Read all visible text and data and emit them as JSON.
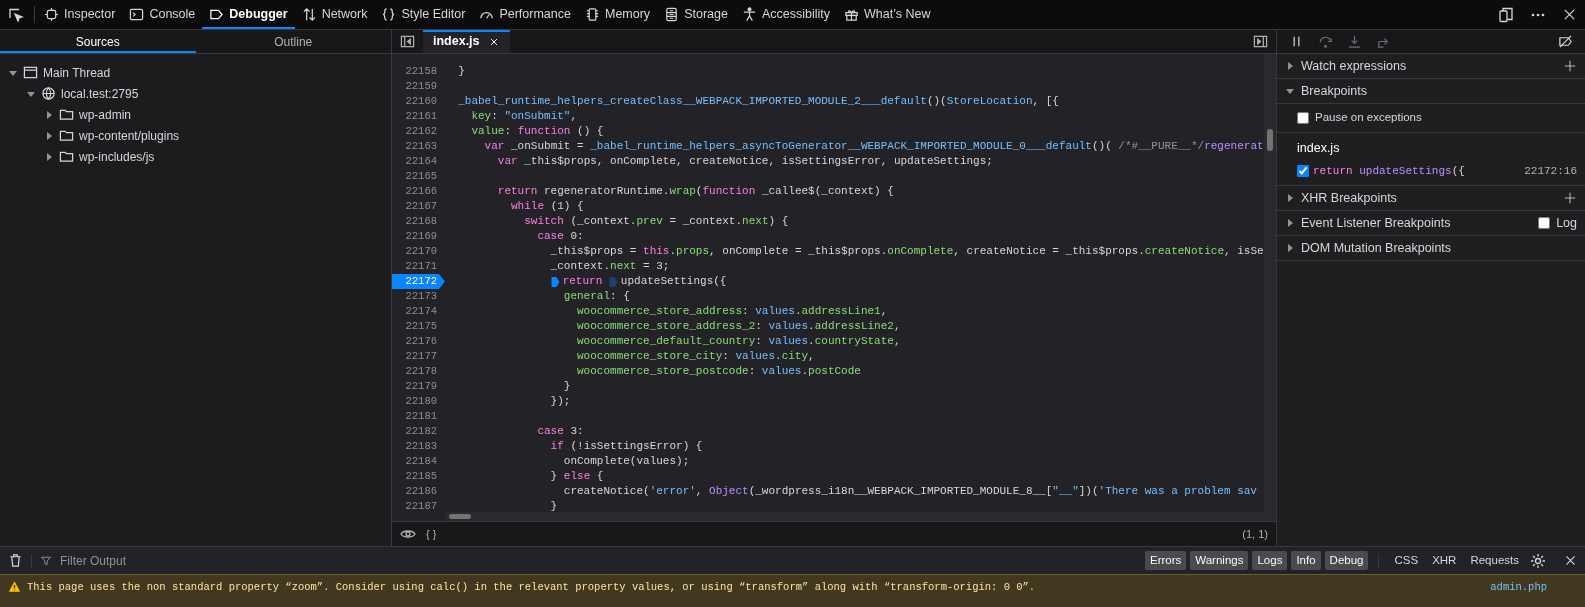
{
  "toolbar": {
    "tabs": [
      {
        "label": "Inspector",
        "kind": "inspector",
        "selected": false
      },
      {
        "label": "Console",
        "kind": "console",
        "selected": false
      },
      {
        "label": "Debugger",
        "kind": "debugger",
        "selected": true
      },
      {
        "label": "Network",
        "kind": "network",
        "selected": false
      },
      {
        "label": "Style Editor",
        "kind": "style",
        "selected": false
      },
      {
        "label": "Performance",
        "kind": "performance",
        "selected": false
      },
      {
        "label": "Memory",
        "kind": "memory",
        "selected": false
      },
      {
        "label": "Storage",
        "kind": "storage",
        "selected": false
      },
      {
        "label": "Accessibility",
        "kind": "accessibility",
        "selected": false
      },
      {
        "label": "What’s New",
        "kind": "whatsnew",
        "selected": false
      }
    ]
  },
  "sources_panel": {
    "tabs": [
      {
        "label": "Sources",
        "selected": true
      },
      {
        "label": "Outline",
        "selected": false
      }
    ],
    "tree": [
      {
        "label": "Main Thread",
        "kind": "thread",
        "expanded": true,
        "children": [
          {
            "label": "local.test:2795",
            "kind": "host",
            "expanded": true,
            "children": [
              {
                "label": "wp-admin",
                "kind": "folder",
                "expanded": false
              },
              {
                "label": "wp-content/plugins",
                "kind": "folder",
                "expanded": false
              },
              {
                "label": "wp-includes/js",
                "kind": "folder",
                "expanded": false
              }
            ]
          }
        ]
      }
    ]
  },
  "editor": {
    "tabs": [
      {
        "label": "index.js",
        "selected": true
      }
    ],
    "lines": [
      {
        "number": "22158",
        "breakpoint": false,
        "tokens": [
          {
            "kind": "plain",
            "text": "  }"
          }
        ]
      },
      {
        "number": "22159",
        "breakpoint": false
      },
      {
        "number": "22160",
        "breakpoint": false,
        "tokens": [
          {
            "kind": "identifier",
            "text": "  _babel_runtime_helpers_createClass__WEBPACK_IMPORTED_MODULE_2___default"
          },
          {
            "kind": "plain",
            "text": "()("
          },
          {
            "kind": "identifier",
            "text": "StoreLocation"
          },
          {
            "kind": "plain",
            "text": ", [{"
          }
        ]
      },
      {
        "number": "22161",
        "breakpoint": false,
        "tokens": [
          {
            "kind": "property",
            "text": "    key"
          },
          {
            "kind": "plain",
            "text": ": "
          },
          {
            "kind": "string",
            "text": "\"onSubmit\""
          },
          {
            "kind": "plain",
            "text": ","
          }
        ]
      },
      {
        "number": "22162",
        "breakpoint": false,
        "tokens": [
          {
            "kind": "property",
            "text": "    value"
          },
          {
            "kind": "plain",
            "text": ": "
          },
          {
            "kind": "keyword",
            "text": "function"
          },
          {
            "kind": "plain",
            "text": " () {"
          }
        ]
      },
      {
        "number": "22163",
        "breakpoint": false,
        "tokens": [
          {
            "kind": "keyword",
            "text": "      var"
          },
          {
            "kind": "plain",
            "text": " _onSubmit = "
          },
          {
            "kind": "identifier",
            "text": "_babel_runtime_helpers_asyncToGenerator__WEBPACK_IMPORTED_MODULE_0___default"
          },
          {
            "kind": "plain",
            "text": "()( "
          },
          {
            "kind": "comment",
            "text": "/*#__PURE__*/"
          },
          {
            "kind": "function",
            "text": "regenerat"
          }
        ]
      },
      {
        "number": "22164",
        "breakpoint": false,
        "tokens": [
          {
            "kind": "keyword",
            "text": "        var"
          },
          {
            "kind": "plain",
            "text": " _this$props, onComplete, createNotice, isSettingsError, updateSettings;"
          }
        ]
      },
      {
        "number": "22165",
        "breakpoint": false
      },
      {
        "number": "22166",
        "breakpoint": false,
        "tokens": [
          {
            "kind": "keyword",
            "text": "        return"
          },
          {
            "kind": "plain",
            "text": " regeneratorRuntime."
          },
          {
            "kind": "property",
            "text": "wrap"
          },
          {
            "kind": "plain",
            "text": "("
          },
          {
            "kind": "keyword",
            "text": "function"
          },
          {
            "kind": "plain",
            "text": " _callee$(_context) {"
          }
        ]
      },
      {
        "number": "22167",
        "breakpoint": false,
        "tokens": [
          {
            "kind": "keyword",
            "text": "          while"
          },
          {
            "kind": "plain",
            "text": " (1) {"
          }
        ]
      },
      {
        "number": "22168",
        "breakpoint": false,
        "tokens": [
          {
            "kind": "keyword",
            "text": "            switch"
          },
          {
            "kind": "plain",
            "text": " (_context."
          },
          {
            "kind": "property",
            "text": "prev"
          },
          {
            "kind": "plain",
            "text": " = _context."
          },
          {
            "kind": "property",
            "text": "next"
          },
          {
            "kind": "plain",
            "text": ") {"
          }
        ]
      },
      {
        "number": "22169",
        "breakpoint": false,
        "tokens": [
          {
            "kind": "keyword",
            "text": "              case"
          },
          {
            "kind": "plain",
            "text": " 0:"
          }
        ]
      },
      {
        "number": "22170",
        "breakpoint": false,
        "tokens": [
          {
            "kind": "plain",
            "text": "                _this$props = "
          },
          {
            "kind": "keyword",
            "text": "this"
          },
          {
            "kind": "plain",
            "text": "."
          },
          {
            "kind": "property",
            "text": "props"
          },
          {
            "kind": "plain",
            "text": ", onComplete = _this$props."
          },
          {
            "kind": "property",
            "text": "onComplete"
          },
          {
            "kind": "plain",
            "text": ", createNotice = _this$props."
          },
          {
            "kind": "property",
            "text": "createNotice"
          },
          {
            "kind": "plain",
            "text": ", isSe"
          }
        ]
      },
      {
        "number": "22171",
        "breakpoint": false,
        "tokens": [
          {
            "kind": "plain",
            "text": "                _context."
          },
          {
            "kind": "property",
            "text": "next"
          },
          {
            "kind": "plain",
            "text": " = 3;"
          }
        ]
      },
      {
        "number": "22172",
        "breakpoint": true,
        "tokens": [
          {
            "kind": "keyword",
            "text": "                return",
            "column_breakpoint": {
              "enabled": true
            }
          },
          {
            "kind": "plain",
            "text": " updateSettings({",
            "column_breakpoint": {
              "enabled": false
            }
          }
        ]
      },
      {
        "number": "22173",
        "breakpoint": false,
        "tokens": [
          {
            "kind": "property",
            "text": "                  general"
          },
          {
            "kind": "plain",
            "text": ": {"
          }
        ]
      },
      {
        "number": "22174",
        "breakpoint": false,
        "tokens": [
          {
            "kind": "property",
            "text": "                    woocommerce_store_address"
          },
          {
            "kind": "plain",
            "text": ": "
          },
          {
            "kind": "identifier",
            "text": "values"
          },
          {
            "kind": "plain",
            "text": "."
          },
          {
            "kind": "property",
            "text": "addressLine1"
          },
          {
            "kind": "plain",
            "text": ","
          }
        ]
      },
      {
        "number": "22175",
        "breakpoint": false,
        "tokens": [
          {
            "kind": "property",
            "text": "                    woocommerce_store_address_2"
          },
          {
            "kind": "plain",
            "text": ": "
          },
          {
            "kind": "identifier",
            "text": "values"
          },
          {
            "kind": "plain",
            "text": "."
          },
          {
            "kind": "property",
            "text": "addressLine2"
          },
          {
            "kind": "plain",
            "text": ","
          }
        ]
      },
      {
        "number": "22176",
        "breakpoint": false,
        "tokens": [
          {
            "kind": "property",
            "text": "                    woocommerce_default_country"
          },
          {
            "kind": "plain",
            "text": ": "
          },
          {
            "kind": "identifier",
            "text": "values"
          },
          {
            "kind": "plain",
            "text": "."
          },
          {
            "kind": "property",
            "text": "countryState"
          },
          {
            "kind": "plain",
            "text": ","
          }
        ]
      },
      {
        "number": "22177",
        "breakpoint": false,
        "tokens": [
          {
            "kind": "property",
            "text": "                    woocommerce_store_city"
          },
          {
            "kind": "plain",
            "text": ": "
          },
          {
            "kind": "identifier",
            "text": "values"
          },
          {
            "kind": "plain",
            "text": "."
          },
          {
            "kind": "property",
            "text": "city"
          },
          {
            "kind": "plain",
            "text": ","
          }
        ]
      },
      {
        "number": "22178",
        "breakpoint": false,
        "tokens": [
          {
            "kind": "property",
            "text": "                    woocommerce_store_postcode"
          },
          {
            "kind": "plain",
            "text": ": "
          },
          {
            "kind": "identifier",
            "text": "values"
          },
          {
            "kind": "plain",
            "text": "."
          },
          {
            "kind": "property",
            "text": "postCode"
          }
        ]
      },
      {
        "number": "22179",
        "breakpoint": false,
        "tokens": [
          {
            "kind": "plain",
            "text": "                  }"
          }
        ]
      },
      {
        "number": "22180",
        "breakpoint": false,
        "tokens": [
          {
            "kind": "plain",
            "text": "                });"
          }
        ]
      },
      {
        "number": "22181",
        "breakpoint": false
      },
      {
        "number": "22182",
        "breakpoint": false,
        "tokens": [
          {
            "kind": "keyword",
            "text": "              case"
          },
          {
            "kind": "plain",
            "text": " 3:"
          }
        ]
      },
      {
        "number": "22183",
        "breakpoint": false,
        "tokens": [
          {
            "kind": "keyword",
            "text": "                if"
          },
          {
            "kind": "plain",
            "text": " (!isSettingsError) {"
          }
        ]
      },
      {
        "number": "22184",
        "breakpoint": false,
        "tokens": [
          {
            "kind": "plain",
            "text": "                  onComplete(values);"
          }
        ]
      },
      {
        "number": "22185",
        "breakpoint": false,
        "tokens": [
          {
            "kind": "plain",
            "text": "                } "
          },
          {
            "kind": "keyword",
            "text": "else"
          },
          {
            "kind": "plain",
            "text": " {"
          }
        ]
      },
      {
        "number": "22186",
        "breakpoint": false,
        "tokens": [
          {
            "kind": "plain",
            "text": "                  createNotice("
          },
          {
            "kind": "string",
            "text": "'error'"
          },
          {
            "kind": "plain",
            "text": ", "
          },
          {
            "kind": "function",
            "text": "Object"
          },
          {
            "kind": "plain",
            "text": "(_wordpress_i18n__WEBPACK_IMPORTED_MODULE_8__["
          },
          {
            "kind": "string",
            "text": "\"__\""
          },
          {
            "kind": "plain",
            "text": "])("
          },
          {
            "kind": "string",
            "text": "'There was a problem sav"
          }
        ]
      },
      {
        "number": "22187",
        "breakpoint": false,
        "tokens": [
          {
            "kind": "plain",
            "text": "                }"
          }
        ]
      }
    ],
    "footer": {
      "pretty_print": "{ }",
      "cursor": "(1, 1)"
    }
  },
  "debugger_panel": {
    "controls": [
      {
        "kind": "pause",
        "disabled": false
      },
      {
        "kind": "step_over",
        "disabled": true
      },
      {
        "kind": "step_in",
        "disabled": true
      },
      {
        "kind": "step_out",
        "disabled": true
      },
      {
        "kind": "toggle_breakpoints",
        "disabled": false
      }
    ],
    "sections": [
      {
        "title": "Watch expressions",
        "expanded": false,
        "add_button": true
      },
      {
        "title": "Breakpoints",
        "expanded": true,
        "pause_on_exceptions": {
          "label": "Pause on exceptions",
          "checked": false
        },
        "breakpoints": [
          {
            "file": "index.js",
            "enabled": true,
            "tokens": [
              {
                "kind": "keyword",
                "text": "return"
              },
              {
                "kind": "function",
                "text": " updateSettings"
              },
              {
                "kind": "plain",
                "text": "({"
              }
            ],
            "location": "22172:16"
          }
        ]
      },
      {
        "title": "XHR Breakpoints",
        "expanded": false,
        "add_button": true
      },
      {
        "title": "Event Listener Breakpoints",
        "expanded": false,
        "log": {
          "label": "Log",
          "checked": false
        }
      },
      {
        "title": "DOM Mutation Breakpoints",
        "expanded": false
      }
    ]
  },
  "console": {
    "filter": {
      "placeholder": "Filter Output"
    },
    "level_filters": [
      {
        "label": "Errors",
        "selected": true
      },
      {
        "label": "Warnings",
        "selected": true
      },
      {
        "label": "Logs",
        "selected": true
      },
      {
        "label": "Info",
        "selected": true
      },
      {
        "label": "Debug",
        "selected": true
      }
    ],
    "type_filters": [
      {
        "label": "CSS",
        "selected": false
      },
      {
        "label": "XHR",
        "selected": false
      },
      {
        "label": "Requests",
        "selected": false
      }
    ],
    "messages": [
      {
        "kind": "warning",
        "text": "This page uses the non standard property “zoom”. Consider using calc() in the relevant property values, or using “transform” along with “transform-origin: 0 0”.",
        "source": "admin.php"
      }
    ]
  }
}
